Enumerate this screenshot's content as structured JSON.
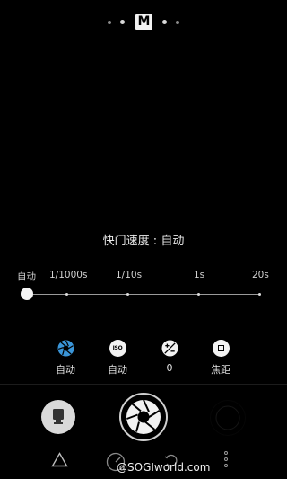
{
  "mode_indicator": {
    "current_mode": "M",
    "accent": "#f2f2f2"
  },
  "shutter_speed": {
    "caption": "快门速度 : 自动"
  },
  "slider": {
    "ticks": [
      "自动",
      "1/1000s",
      "1/10s",
      "1s",
      "20s"
    ],
    "selected": "自动"
  },
  "params": [
    {
      "icon": "aperture-icon",
      "label": "自动",
      "color": "#3a95d8"
    },
    {
      "icon": "iso-icon",
      "icon_text": "ISO",
      "label": "自动"
    },
    {
      "icon": "exposure-compensation-icon",
      "label": "0"
    },
    {
      "icon": "focus-icon",
      "label": "焦距"
    }
  ],
  "bottom": {
    "left_button_icon": "camera-switch-icon",
    "shutter_icon": "aperture-icon",
    "right_button_icon": "gallery-icon"
  },
  "nav": {
    "watermark": "@SOGIworld.com",
    "icons": [
      "triangle-icon",
      "gauge-icon",
      "rotate-icon",
      "more-icon"
    ]
  }
}
